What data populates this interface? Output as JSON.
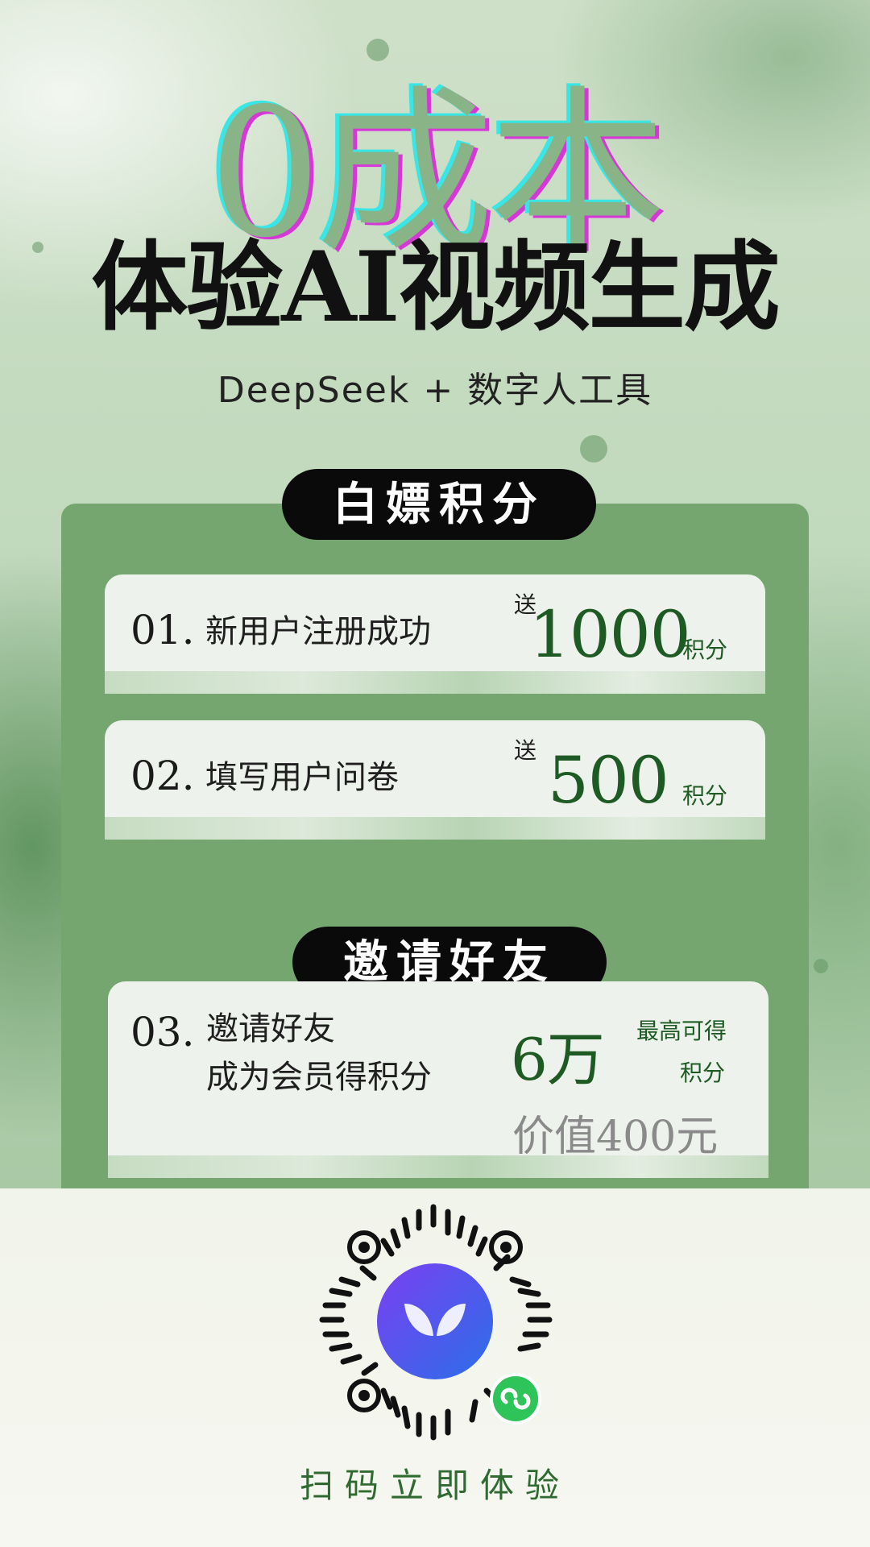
{
  "header": {
    "big_title": "0成本",
    "main_title": "体验AI视频生成",
    "subtitle": "DeepSeek + 数字人工具"
  },
  "section1": {
    "label": "白嫖积分",
    "items": [
      {
        "num": "01.",
        "desc": "新用户注册成功",
        "send": "送",
        "value": "1000",
        "unit": "积分"
      },
      {
        "num": "02.",
        "desc": "填写用户问卷",
        "send": "送",
        "value": "500",
        "unit": "积分"
      }
    ]
  },
  "section2": {
    "label": "邀请好友",
    "item": {
      "num": "03.",
      "desc_line1": "邀请好友",
      "desc_line2": "成为会员得积分",
      "value": "6万",
      "note_line1": "最高可得",
      "note_line2": "积分",
      "worth": "价值400元"
    }
  },
  "footer": {
    "cta": "扫码立即体验",
    "qr_icon": "mini-program-qr-icon"
  },
  "colors": {
    "panel": "#75a66f",
    "accent_green": "#1e5a23",
    "cta_green": "#2f6a31"
  }
}
